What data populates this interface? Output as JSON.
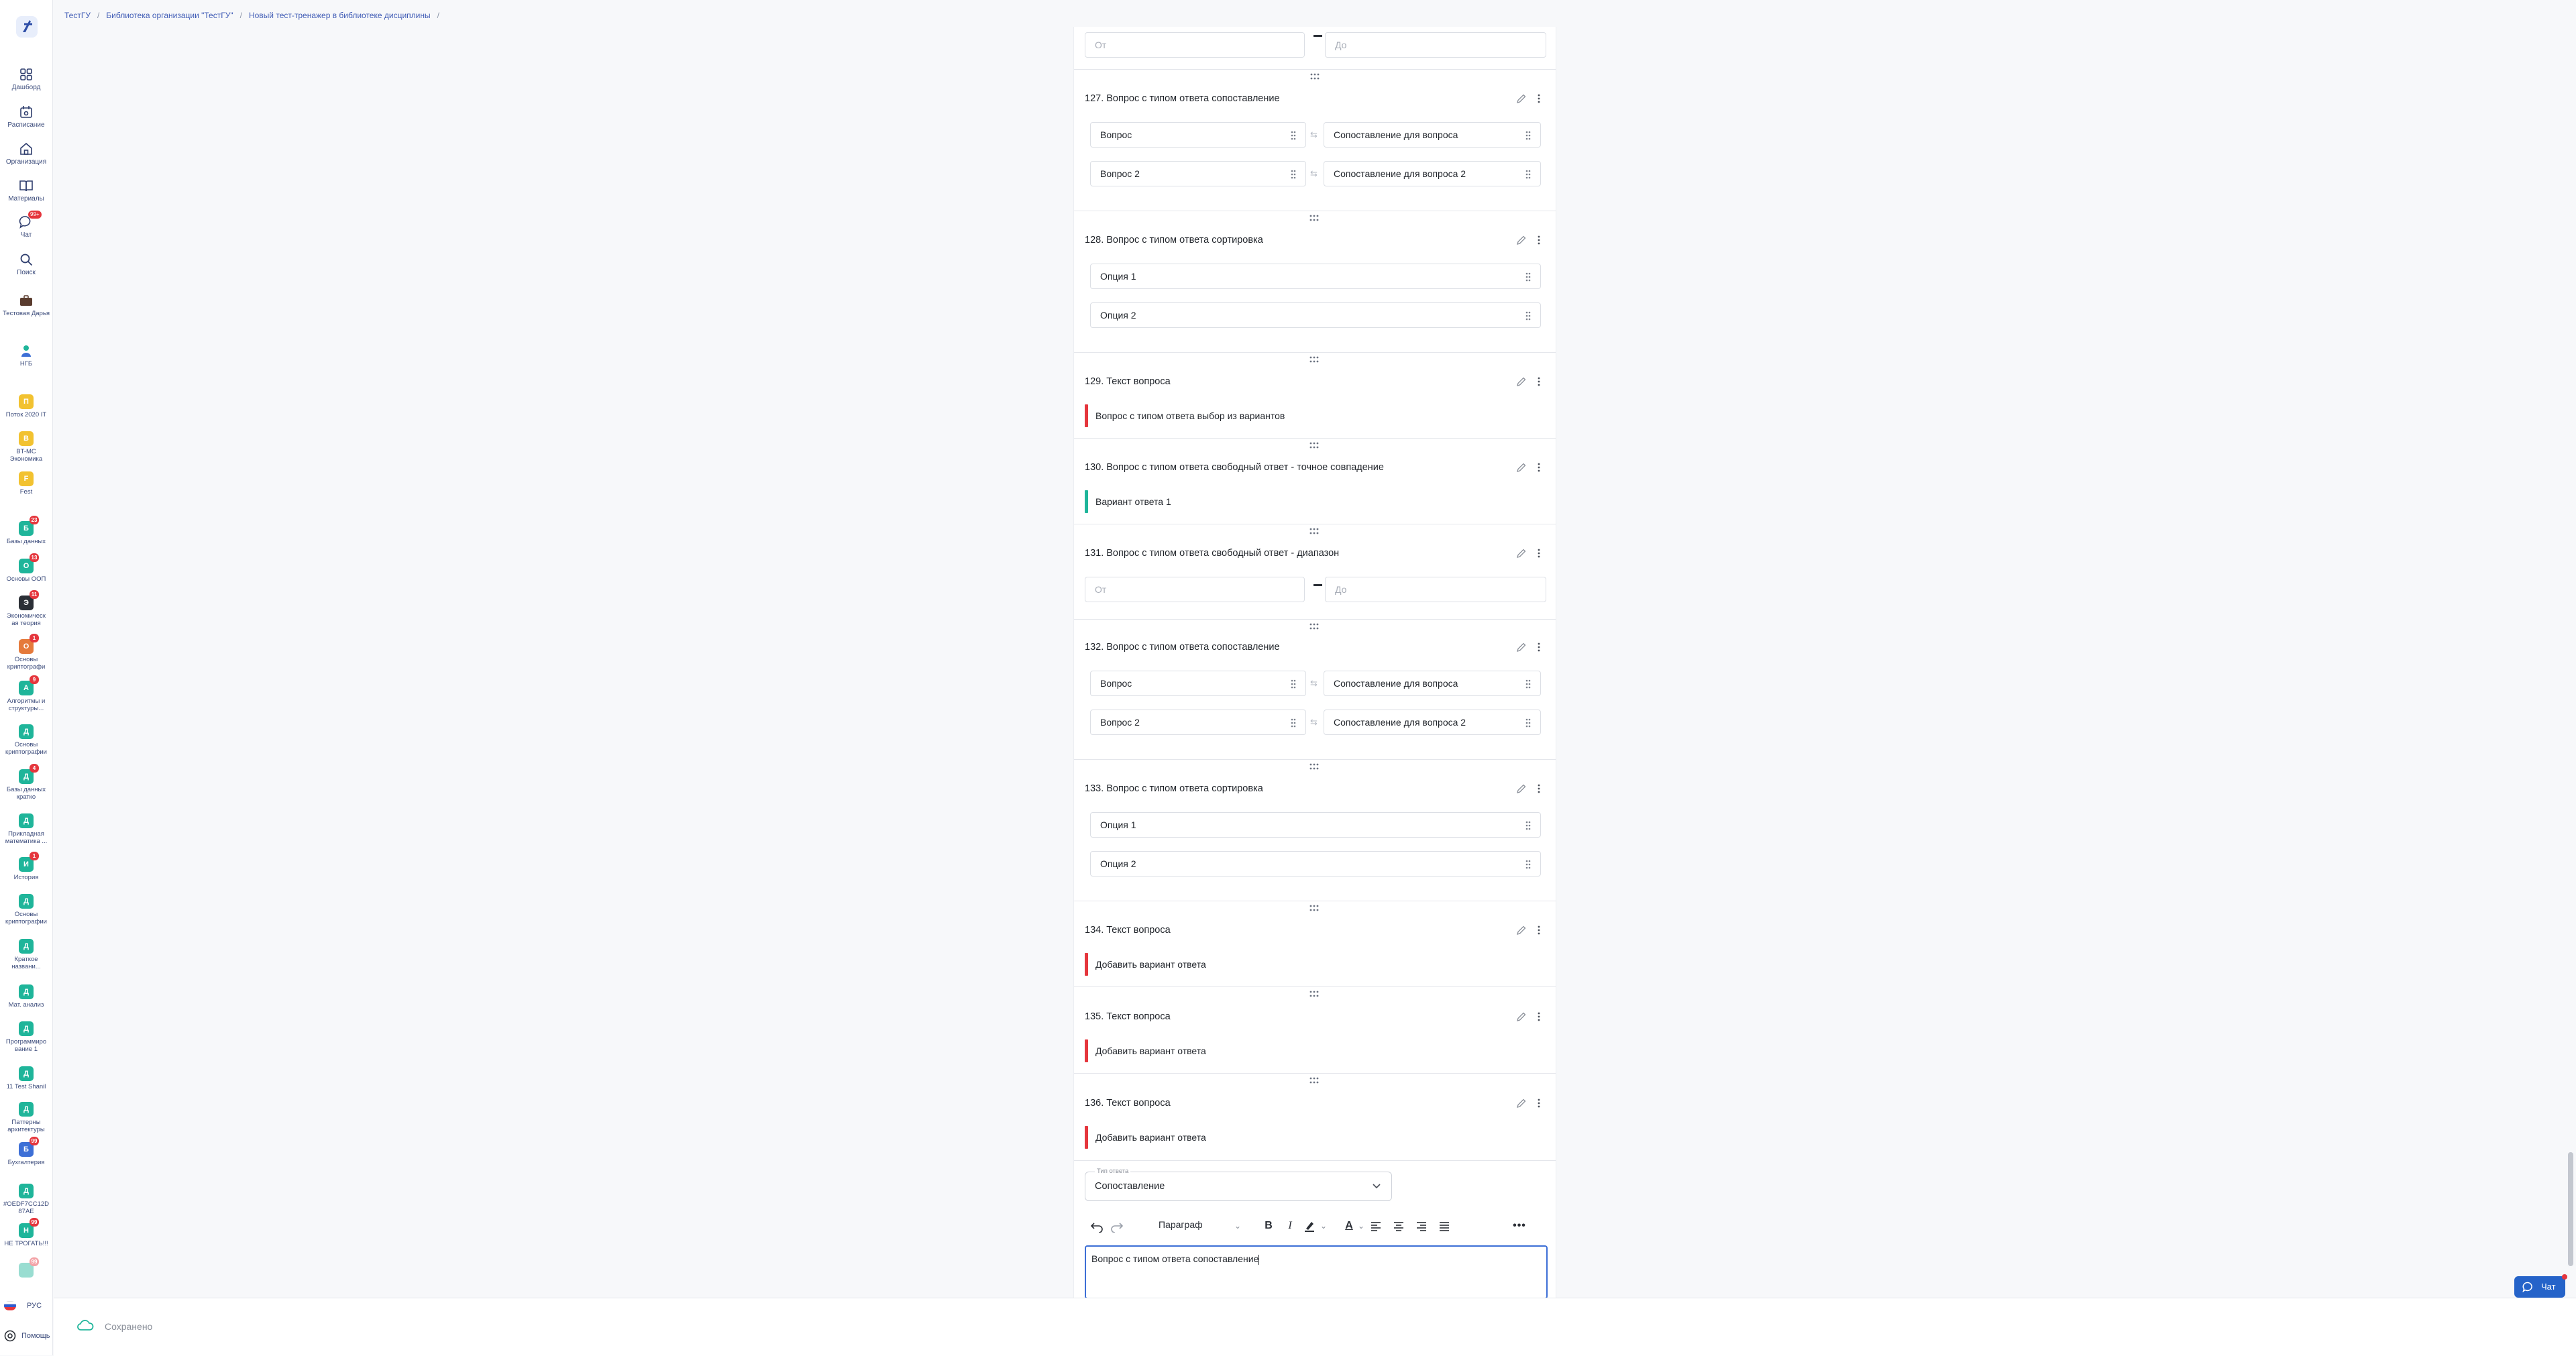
{
  "breadcrumb": [
    "ТестГУ",
    "Библиотека организации \"ТестГУ\"",
    "Новый тест-тренажер в библиотеке дисциплины"
  ],
  "nav": [
    {
      "label": "Дашборд",
      "icon": "dashboard-icon"
    },
    {
      "label": "Расписание",
      "icon": "calendar-icon"
    },
    {
      "label": "Организация",
      "icon": "home-icon"
    },
    {
      "label": "Материалы",
      "icon": "book-icon"
    },
    {
      "label": "Чат",
      "icon": "chat-icon",
      "badge": "99+"
    },
    {
      "label": "Поиск",
      "icon": "search-icon"
    }
  ],
  "profile": [
    {
      "label": "Тестовая Дарья",
      "icon": "briefcase-icon"
    },
    {
      "label": "НГБ",
      "icon": "user-icon"
    }
  ],
  "courses": [
    {
      "line1": "Поток 2020 IT",
      "line2": "",
      "letter": "П",
      "color": "#f2c230",
      "badge": ""
    },
    {
      "line1": "BT-MC",
      "line2": "Экономика",
      "letter": "В",
      "color": "#f2c230",
      "badge": ""
    },
    {
      "line1": "Fest",
      "line2": "",
      "letter": "F",
      "color": "#f2c230",
      "badge": ""
    },
    {
      "line1": "Базы данных",
      "line2": "",
      "letter": "Б",
      "color": "#1fb59a",
      "badge": "23"
    },
    {
      "line1": "Основы ООП",
      "line2": "",
      "letter": "О",
      "color": "#1fb59a",
      "badge": "13"
    },
    {
      "line1": "Экономическ",
      "line2": "ая теория",
      "letter": "Э",
      "color": "#2b2f36",
      "badge": "11"
    },
    {
      "line1": "Основы",
      "line2": "криптографи",
      "letter": "О",
      "color": "#e57a3b",
      "badge": "1"
    },
    {
      "line1": "Алгоритмы и",
      "line2": "структуры...",
      "letter": "А",
      "color": "#1fb59a",
      "badge": "9"
    },
    {
      "line1": "Основы",
      "line2": "криптографии",
      "letter": "Д",
      "color": "#1fb59a",
      "badge": ""
    },
    {
      "line1": "Базы данных",
      "line2": "кратко",
      "letter": "Д",
      "color": "#1fb59a",
      "badge": "4"
    },
    {
      "line1": "Прикладная",
      "line2": "математика ...",
      "letter": "Д",
      "color": "#1fb59a",
      "badge": ""
    },
    {
      "line1": "История",
      "line2": "",
      "letter": "И",
      "color": "#1fb59a",
      "badge": "1"
    },
    {
      "line1": "Основы",
      "line2": "криптографии",
      "letter": "Д",
      "color": "#1fb59a",
      "badge": ""
    },
    {
      "line1": "Краткое",
      "line2": "названи...",
      "letter": "Д",
      "color": "#1fb59a",
      "badge": ""
    },
    {
      "line1": "Мат. анализ",
      "line2": "",
      "letter": "Д",
      "color": "#1fb59a",
      "badge": ""
    },
    {
      "line1": "Программиро",
      "line2": "вание 1",
      "letter": "Д",
      "color": "#1fb59a",
      "badge": ""
    },
    {
      "line1": "11 Test Shanil",
      "line2": "",
      "letter": "Д",
      "color": "#1fb59a",
      "badge": ""
    },
    {
      "line1": "Паттерны",
      "line2": "архитектуры",
      "letter": "Д",
      "color": "#1fb59a",
      "badge": ""
    },
    {
      "line1": "Бухгалтерия",
      "line2": "",
      "letter": "Б",
      "color": "#3d6fd6",
      "badge": "99"
    },
    {
      "line1": "#OEDF7CC12D",
      "line2": "87AE",
      "letter": "Д",
      "color": "#1fb59a",
      "badge": ""
    },
    {
      "line1": "НЕ ТРОГАТЬ!!!",
      "line2": "",
      "letter": "Н",
      "color": "#1fb59a",
      "badge": "99"
    },
    {
      "line1": "",
      "line2": "",
      "letter": "",
      "color": "#1fb59a",
      "badge": "99"
    }
  ],
  "range_top": {
    "from": "От",
    "to": "До"
  },
  "questions": {
    "q127": {
      "title": "127.  Вопрос с типом ответа сопоставление",
      "left1": "Вопрос",
      "left2": "Вопрос 2",
      "right1": "Сопоставление для вопроса",
      "right2": "Сопоставление для вопроса 2"
    },
    "q128": {
      "title": "128.  Вопрос с типом ответа сортировка",
      "opt1": "Опция 1",
      "opt2": "Опция 2"
    },
    "q129": {
      "title": "129.  Текст вопроса",
      "answer": "Вопрос с типом ответа выбор из вариантов"
    },
    "q130": {
      "title": "130.  Вопрос с типом ответа свободный ответ - точное совпадение",
      "answer": "Вариант ответа 1"
    },
    "q131": {
      "title": "131.  Вопрос с типом ответа свободный ответ - диапазон",
      "from": "От",
      "to": "До"
    },
    "q132": {
      "title": "132.  Вопрос с типом ответа сопоставление",
      "left1": "Вопрос",
      "left2": "Вопрос 2",
      "right1": "Сопоставление для вопроса",
      "right2": "Сопоставление для вопроса 2"
    },
    "q133": {
      "title": "133.  Вопрос с типом ответа сортировка",
      "opt1": "Опция 1",
      "opt2": "Опция 2"
    },
    "q134": {
      "title": "134.  Текст вопроса",
      "answer": "Добавить вариант ответа"
    },
    "q135": {
      "title": "135.  Текст вопроса",
      "answer": "Добавить вариант ответа"
    },
    "q136": {
      "title": "136.  Текст вопроса",
      "answer": "Добавить вариант ответа"
    }
  },
  "editor": {
    "type_label": "Тип ответа",
    "type_value": "Сопоставление",
    "paragraph": "Параграф",
    "text": "Вопрос с типом ответа сопоставление"
  },
  "footer": {
    "status": "Сохранено",
    "lang": "РУС",
    "help": "Помощь"
  },
  "chat_button": "Чат",
  "colors": {
    "red_bar": "#e5363d",
    "green_bar": "#1fb59a",
    "accent": "#3d6fd6"
  }
}
